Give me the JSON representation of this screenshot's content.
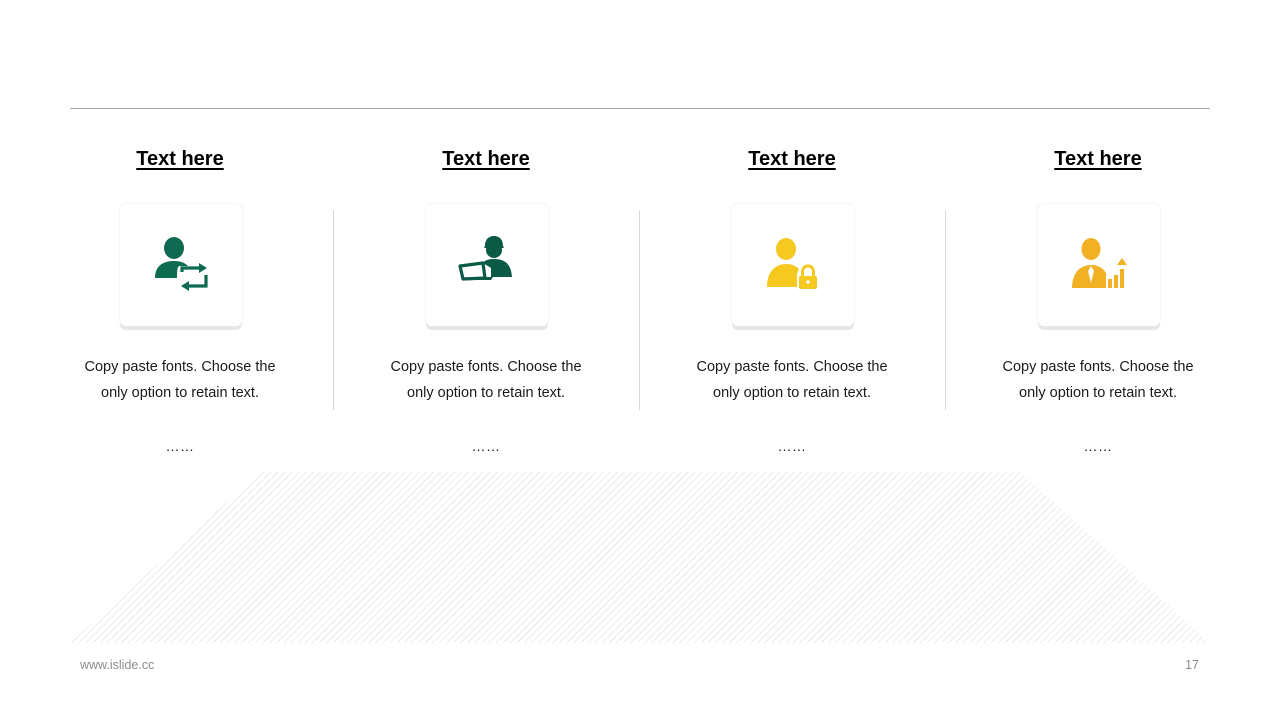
{
  "columns": [
    {
      "title": "Text here",
      "desc_line1": "Copy paste fonts. Choose the",
      "desc_line2": "only option to retain text.",
      "dots": "……",
      "icon": "user-sync-icon",
      "icon_color": "#0e6b52"
    },
    {
      "title": "Text here",
      "desc_line1": "Copy paste fonts. Choose the",
      "desc_line2": "only option to retain text.",
      "dots": "……",
      "icon": "user-laptop-icon",
      "icon_color": "#0a5a45"
    },
    {
      "title": "Text here",
      "desc_line1": "Copy paste fonts. Choose the",
      "desc_line2": "only option to retain text.",
      "dots": "……",
      "icon": "user-lock-icon",
      "icon_color": "#f5c91f"
    },
    {
      "title": "Text here",
      "desc_line1": "Copy paste fonts. Choose the",
      "desc_line2": "only option to retain text.",
      "dots": "……",
      "icon": "user-growth-chart-icon",
      "icon_color": "#f2b024"
    }
  ],
  "footer": {
    "site": "www.islide.cc",
    "page": "17"
  },
  "colors": {
    "rule": "#a6a6a6",
    "divider": "#d9d9d9",
    "floor_hatch": "#dcdcdc"
  }
}
